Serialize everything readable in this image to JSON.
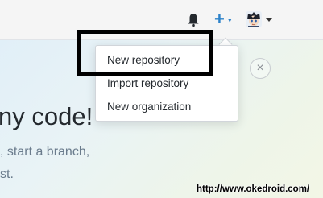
{
  "header": {
    "notifications_icon": "bell-icon",
    "create_icon": "plus-icon",
    "create_plus_glyph": "+",
    "create_caret_glyph": "▾",
    "avatar_icon": "avatar-icon"
  },
  "dropdown": {
    "items": [
      {
        "label": "New repository"
      },
      {
        "label": "Import repository"
      },
      {
        "label": "New organization"
      }
    ]
  },
  "highlight": {
    "color": "#000000"
  },
  "close_button": {
    "icon": "close-icon",
    "glyph": "×"
  },
  "hero": {
    "title": "ny code!",
    "line1": ", start a branch,",
    "line2": "st."
  },
  "watermark": {
    "text": "http://www.okedroid.com/"
  },
  "colors": {
    "accent": "#2c82c9",
    "text": "#24292e",
    "muted": "#6a7b8c"
  }
}
